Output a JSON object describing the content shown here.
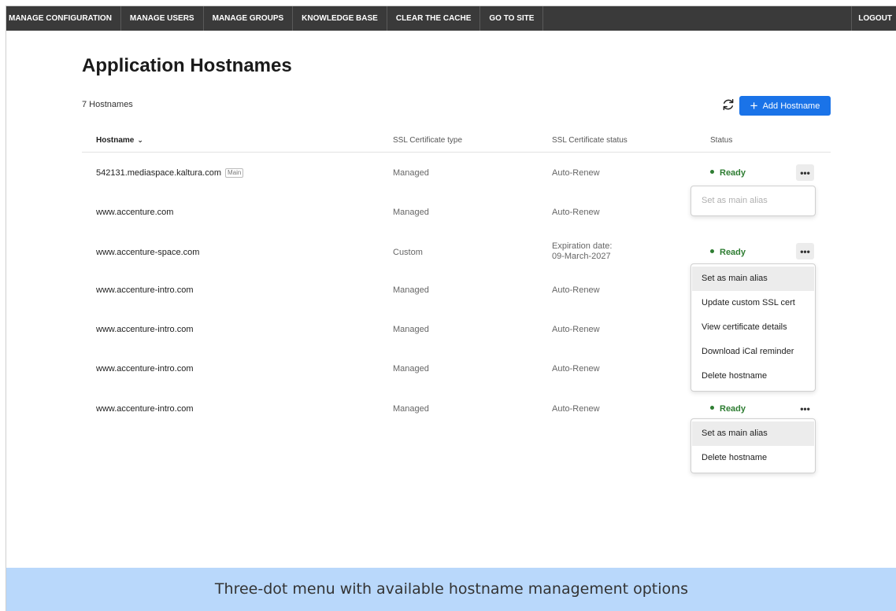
{
  "nav": {
    "items": [
      "MANAGE CONFIGURATION",
      "MANAGE USERS",
      "MANAGE GROUPS",
      "KNOWLEDGE BASE",
      "CLEAR THE CACHE",
      "GO TO SITE"
    ],
    "logout": "LOGOUT"
  },
  "page": {
    "title": "Application Hostnames",
    "count": "7 Hostnames",
    "add_button": "Add Hostname"
  },
  "table": {
    "headers": {
      "hostname": "Hostname",
      "ssl_type": "SSL Certificate type",
      "ssl_status": "SSL Certificate status",
      "status": "Status"
    },
    "main_tag": "Main",
    "rows": [
      {
        "hostname": "542131.mediaspace.kaltura.com",
        "ssl_type": "Managed",
        "ssl_status": "Auto-Renew",
        "status": "Ready"
      },
      {
        "hostname": "www.accenture.com",
        "ssl_type": "Managed",
        "ssl_status": "Auto-Renew",
        "status": ""
      },
      {
        "hostname": "www.accenture-space.com",
        "ssl_type": "Custom",
        "ssl_status_line1": "Expiration date:",
        "ssl_status_line2": "09-March-2027",
        "status": "Ready"
      },
      {
        "hostname": "www.accenture-intro.com",
        "ssl_type": "Managed",
        "ssl_status": "Auto-Renew",
        "status": ""
      },
      {
        "hostname": "www.accenture-intro.com",
        "ssl_type": "Managed",
        "ssl_status": "Auto-Renew",
        "status": ""
      },
      {
        "hostname": "www.accenture-intro.com",
        "ssl_type": "Managed",
        "ssl_status": "Auto-Renew",
        "status": ""
      },
      {
        "hostname": "www.accenture-intro.com",
        "ssl_type": "Managed",
        "ssl_status": "Auto-Renew",
        "status": "Ready"
      }
    ]
  },
  "menus": {
    "main_row": [
      "Set as main alias"
    ],
    "custom_row": [
      "Set as main alias",
      "Update custom SSL cert",
      "View certificate details",
      "Download iCal reminder",
      "Delete hostname"
    ],
    "managed_row": [
      "Set as main alias",
      "Delete hostname"
    ]
  },
  "caption": "Three-dot menu with available hostname management options",
  "colors": {
    "nav_bg": "#3a3a3a",
    "accent": "#1a73e8",
    "ready": "#2e7d32",
    "caption_bg": "#b9d8fb"
  },
  "icons": [
    "refresh-icon",
    "plus-icon",
    "chevron-down-icon",
    "more-horizontal-icon"
  ]
}
